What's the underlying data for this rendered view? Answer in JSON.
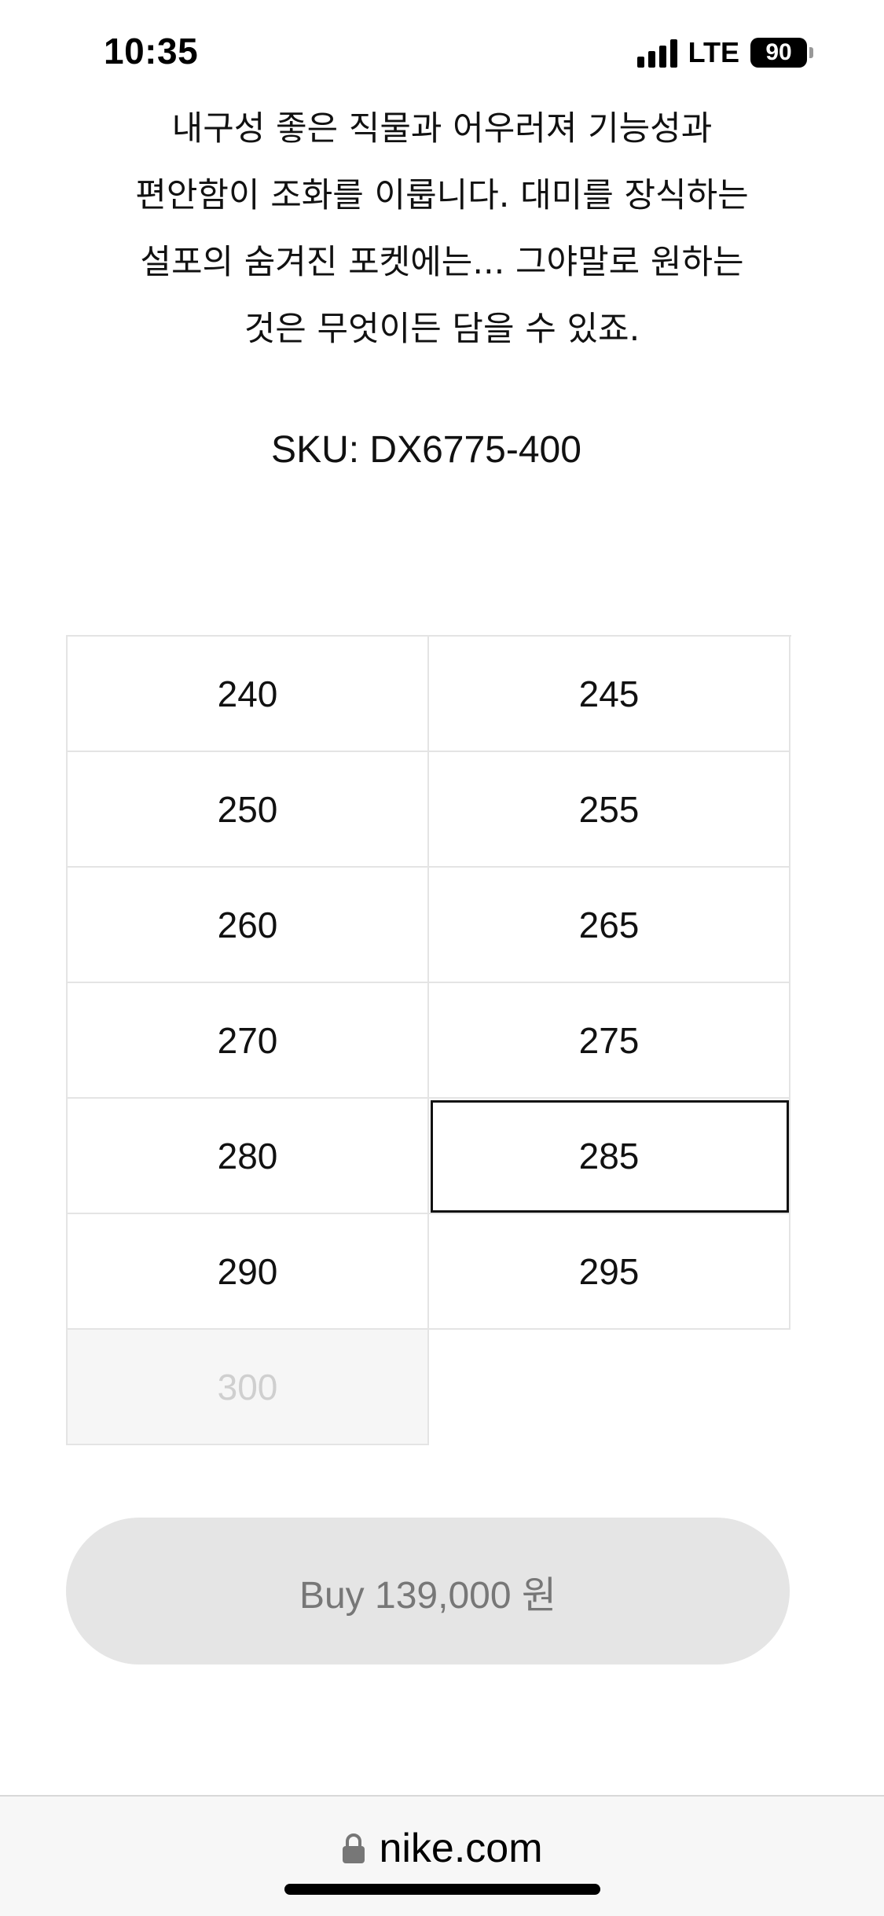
{
  "status_bar": {
    "time": "10:35",
    "network": "LTE",
    "battery": "90"
  },
  "product": {
    "description_lines": [
      "내구성 좋은 직물과 어우러져 기능성과",
      "편안함이 조화를 이룹니다. 대미를 장식하는",
      "설포의 숨겨진 포켓에는... 그야말로 원하는",
      "것은 무엇이든 담을 수 있죠."
    ],
    "sku": "SKU: DX6775-400"
  },
  "sizes": [
    {
      "label": "240",
      "state": "available"
    },
    {
      "label": "245",
      "state": "available"
    },
    {
      "label": "250",
      "state": "available"
    },
    {
      "label": "255",
      "state": "available"
    },
    {
      "label": "260",
      "state": "available"
    },
    {
      "label": "265",
      "state": "available"
    },
    {
      "label": "270",
      "state": "available"
    },
    {
      "label": "275",
      "state": "available"
    },
    {
      "label": "280",
      "state": "available"
    },
    {
      "label": "285",
      "state": "selected"
    },
    {
      "label": "290",
      "state": "available"
    },
    {
      "label": "295",
      "state": "available"
    },
    {
      "label": "300",
      "state": "disabled"
    }
  ],
  "buy_button": {
    "label": "Buy 139,000 원"
  },
  "browser": {
    "url": "nike.com",
    "lock_icon": "lock-icon"
  }
}
